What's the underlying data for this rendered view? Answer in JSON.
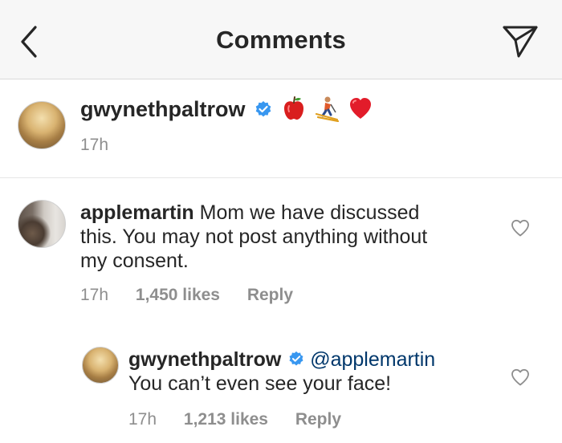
{
  "header": {
    "title": "Comments",
    "back_icon": "chevron-left-icon",
    "send_icon": "paper-plane-icon"
  },
  "caption": {
    "username": "gwynethpaltrow",
    "verified": true,
    "emojis": [
      "apple-emoji",
      "skier-emoji",
      "red-heart-emoji"
    ],
    "time": "17h"
  },
  "comments": [
    {
      "username": "applemartin",
      "text": "Mom we have discussed this. You may not post anything without my consent.",
      "line1_rest": "Mom we have discussed",
      "line2": "this. You may not post anything without",
      "line3": "my consent.",
      "time": "17h",
      "likes": "1,450 likes",
      "reply": "Reply"
    },
    {
      "username": "gwynethpaltrow",
      "verified": true,
      "mention": "@applemartin",
      "text": "You can’t even see your face!",
      "time": "17h",
      "likes": "1,213 likes",
      "reply": "Reply"
    }
  ],
  "colors": {
    "text": "#262626",
    "muted": "#8e8e8e",
    "verified": "#3897f0",
    "mention": "#00376b",
    "header_bg": "#f7f7f7"
  }
}
